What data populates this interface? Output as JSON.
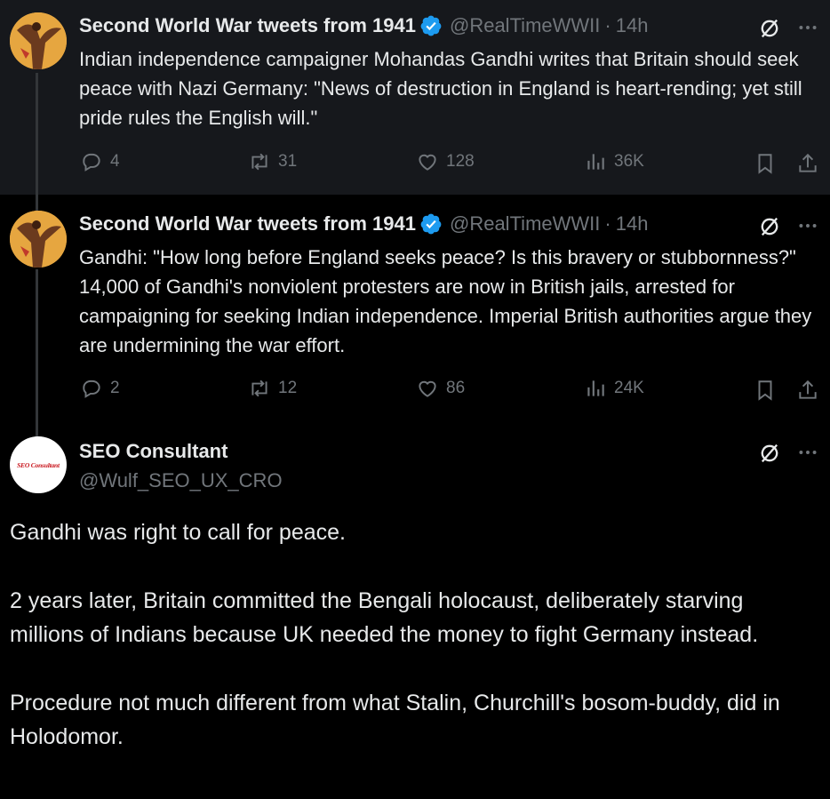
{
  "tweets": [
    {
      "name": "Second World War tweets from 1941",
      "handle": "@RealTimeWWII",
      "dot": "·",
      "time": "14h",
      "text": "Indian independence campaigner Mohandas Gandhi writes that Britain should seek peace with Nazi Germany: \"News of destruction in England is heart-rending; yet still pride rules the English will.\"",
      "replies": "4",
      "reposts": "31",
      "likes": "128",
      "views": "36K"
    },
    {
      "name": "Second World War tweets from 1941",
      "handle": "@RealTimeWWII",
      "dot": "·",
      "time": "14h",
      "text": "Gandhi: \"How long before England seeks peace? Is this bravery or stubbornness?\" 14,000 of Gandhi's nonviolent protesters are now in British jails, arrested for campaigning for seeking Indian independence. Imperial British authorities argue they are undermining the war effort.",
      "replies": "2",
      "reposts": "12",
      "likes": "86",
      "views": "24K"
    }
  ],
  "reply": {
    "name": "SEO Consultant",
    "handle": "@Wulf_SEO_UX_CRO",
    "avatar_text": "SEO Consultant",
    "paragraphs": [
      "Gandhi was right to call for peace.",
      "2 years later, Britain committed the Bengali holocaust, deliberately starving millions of Indians because UK needed the money to fight Germany instead.",
      "Procedure not much different from what Stalin, Churchill's bosom-buddy, did in Holodomor."
    ]
  },
  "colors": {
    "background": "#000000",
    "highlight_background": "#16181c",
    "text": "#e7e9ea",
    "secondary": "#71767b",
    "verified": "#1d9bf0"
  },
  "icons": [
    "verified-badge-icon",
    "grok-icon",
    "more-icon",
    "reply-icon",
    "repost-icon",
    "like-icon",
    "views-icon",
    "bookmark-icon",
    "share-icon"
  ]
}
